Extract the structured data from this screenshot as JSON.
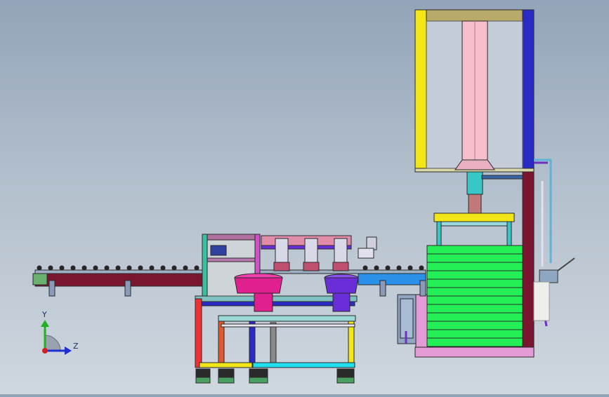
{
  "viewport": {
    "colors": {
      "background_top": "#93a4b9",
      "background_bottom": "#cfd7df",
      "outline": "#2a2a2a"
    }
  },
  "triad": {
    "y_label": "Y",
    "z_label": "Z",
    "icons": [
      "y-axis-arrow-icon",
      "z-axis-arrow-icon",
      "origin-quarter-icon"
    ]
  },
  "model": {
    "parts": [
      "roller-conveyor",
      "vibratory-feeder-magenta",
      "vibratory-feeder-purple",
      "work-station-frame",
      "pneumatic-manipulators",
      "lifting-press-tower",
      "stack-lifting-platform",
      "air-supply-piping"
    ],
    "colors": {
      "conveyor_belt": "#7a1630",
      "frame_yellow": "#f2e619",
      "frame_blue": "#2a2ac4",
      "column_pink": "#f5b3c4",
      "stack_green": "#22ee55",
      "feeder_magenta": "#e0208f",
      "feeder_purple": "#6a2ed8",
      "base_pink": "#e59bd6"
    }
  }
}
